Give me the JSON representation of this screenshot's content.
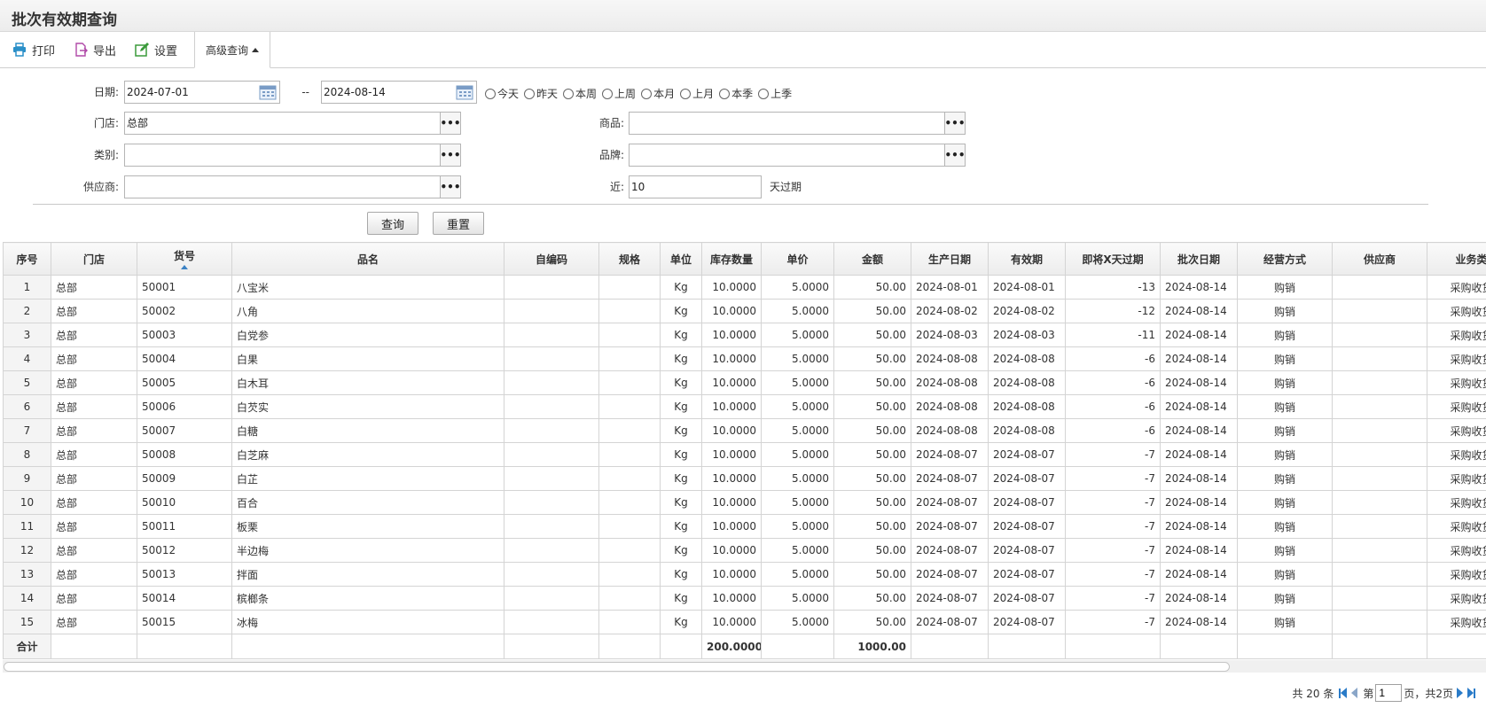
{
  "page": {
    "title": "批次有效期查询"
  },
  "toolbar": {
    "print": "打印",
    "export": "导出",
    "settings": "设置",
    "advanced": "高级查询"
  },
  "filters": {
    "date_label": "日期:",
    "date_from": "2024-07-01",
    "date_sep": "--",
    "date_to": "2024-08-14",
    "quick_ranges": [
      "今天",
      "昨天",
      "本周",
      "上周",
      "本月",
      "上月",
      "本季",
      "上季"
    ],
    "store_label": "门店:",
    "store_value": "总部",
    "product_label": "商品:",
    "product_value": "",
    "category_label": "类别:",
    "category_value": "",
    "brand_label": "品牌:",
    "brand_value": "",
    "supplier_label": "供应商:",
    "supplier_value": "",
    "near_label": "近:",
    "near_value": "10",
    "near_suffix": "天过期",
    "query_button": "查询",
    "reset_button": "重置"
  },
  "table": {
    "columns": [
      "序号",
      "门店",
      "货号",
      "品名",
      "自编码",
      "规格",
      "单位",
      "库存数量",
      "单价",
      "金额",
      "生产日期",
      "有效期",
      "即将X天过期",
      "批次日期",
      "经营方式",
      "供应商",
      "业务类"
    ],
    "rows": [
      [
        "1",
        "总部",
        "50001",
        "八宝米",
        "",
        "",
        "Kg",
        "10.0000",
        "5.0000",
        "50.00",
        "2024-08-01",
        "2024-08-01",
        "-13",
        "2024-08-14",
        "购销",
        "",
        "采购收货"
      ],
      [
        "2",
        "总部",
        "50002",
        "八角",
        "",
        "",
        "Kg",
        "10.0000",
        "5.0000",
        "50.00",
        "2024-08-02",
        "2024-08-02",
        "-12",
        "2024-08-14",
        "购销",
        "",
        "采购收货"
      ],
      [
        "3",
        "总部",
        "50003",
        "白党参",
        "",
        "",
        "Kg",
        "10.0000",
        "5.0000",
        "50.00",
        "2024-08-03",
        "2024-08-03",
        "-11",
        "2024-08-14",
        "购销",
        "",
        "采购收货"
      ],
      [
        "4",
        "总部",
        "50004",
        "白果",
        "",
        "",
        "Kg",
        "10.0000",
        "5.0000",
        "50.00",
        "2024-08-08",
        "2024-08-08",
        "-6",
        "2024-08-14",
        "购销",
        "",
        "采购收货"
      ],
      [
        "5",
        "总部",
        "50005",
        "白木耳",
        "",
        "",
        "Kg",
        "10.0000",
        "5.0000",
        "50.00",
        "2024-08-08",
        "2024-08-08",
        "-6",
        "2024-08-14",
        "购销",
        "",
        "采购收货"
      ],
      [
        "6",
        "总部",
        "50006",
        "白芡实",
        "",
        "",
        "Kg",
        "10.0000",
        "5.0000",
        "50.00",
        "2024-08-08",
        "2024-08-08",
        "-6",
        "2024-08-14",
        "购销",
        "",
        "采购收货"
      ],
      [
        "7",
        "总部",
        "50007",
        "白糖",
        "",
        "",
        "Kg",
        "10.0000",
        "5.0000",
        "50.00",
        "2024-08-08",
        "2024-08-08",
        "-6",
        "2024-08-14",
        "购销",
        "",
        "采购收货"
      ],
      [
        "8",
        "总部",
        "50008",
        "白芝麻",
        "",
        "",
        "Kg",
        "10.0000",
        "5.0000",
        "50.00",
        "2024-08-07",
        "2024-08-07",
        "-7",
        "2024-08-14",
        "购销",
        "",
        "采购收货"
      ],
      [
        "9",
        "总部",
        "50009",
        "白芷",
        "",
        "",
        "Kg",
        "10.0000",
        "5.0000",
        "50.00",
        "2024-08-07",
        "2024-08-07",
        "-7",
        "2024-08-14",
        "购销",
        "",
        "采购收货"
      ],
      [
        "10",
        "总部",
        "50010",
        "百合",
        "",
        "",
        "Kg",
        "10.0000",
        "5.0000",
        "50.00",
        "2024-08-07",
        "2024-08-07",
        "-7",
        "2024-08-14",
        "购销",
        "",
        "采购收货"
      ],
      [
        "11",
        "总部",
        "50011",
        "板栗",
        "",
        "",
        "Kg",
        "10.0000",
        "5.0000",
        "50.00",
        "2024-08-07",
        "2024-08-07",
        "-7",
        "2024-08-14",
        "购销",
        "",
        "采购收货"
      ],
      [
        "12",
        "总部",
        "50012",
        "半边梅",
        "",
        "",
        "Kg",
        "10.0000",
        "5.0000",
        "50.00",
        "2024-08-07",
        "2024-08-07",
        "-7",
        "2024-08-14",
        "购销",
        "",
        "采购收货"
      ],
      [
        "13",
        "总部",
        "50013",
        "拌面",
        "",
        "",
        "Kg",
        "10.0000",
        "5.0000",
        "50.00",
        "2024-08-07",
        "2024-08-07",
        "-7",
        "2024-08-14",
        "购销",
        "",
        "采购收货"
      ],
      [
        "14",
        "总部",
        "50014",
        "槟榔条",
        "",
        "",
        "Kg",
        "10.0000",
        "5.0000",
        "50.00",
        "2024-08-07",
        "2024-08-07",
        "-7",
        "2024-08-14",
        "购销",
        "",
        "采购收货"
      ],
      [
        "15",
        "总部",
        "50015",
        "冰梅",
        "",
        "",
        "Kg",
        "10.0000",
        "5.0000",
        "50.00",
        "2024-08-07",
        "2024-08-07",
        "-7",
        "2024-08-14",
        "购销",
        "",
        "采购收货"
      ]
    ],
    "summary": {
      "label": "合计",
      "qty_total": "200.0000",
      "amount_total": "1000.00"
    }
  },
  "pager": {
    "total_text": "共 20 条",
    "page_prefix": "第",
    "page_value": "1",
    "page_suffix": "页，共2页"
  },
  "colors": {
    "accent": "#2a7bc8",
    "print_icon": "#2a8fc8",
    "export_icon": "#b04aa8",
    "settings_icon": "#3a9a3a"
  },
  "icons": {
    "print": "printer-icon",
    "export": "export-icon",
    "settings": "edit-icon",
    "calendar": "calendar-icon",
    "more": "more-dots-icon"
  }
}
